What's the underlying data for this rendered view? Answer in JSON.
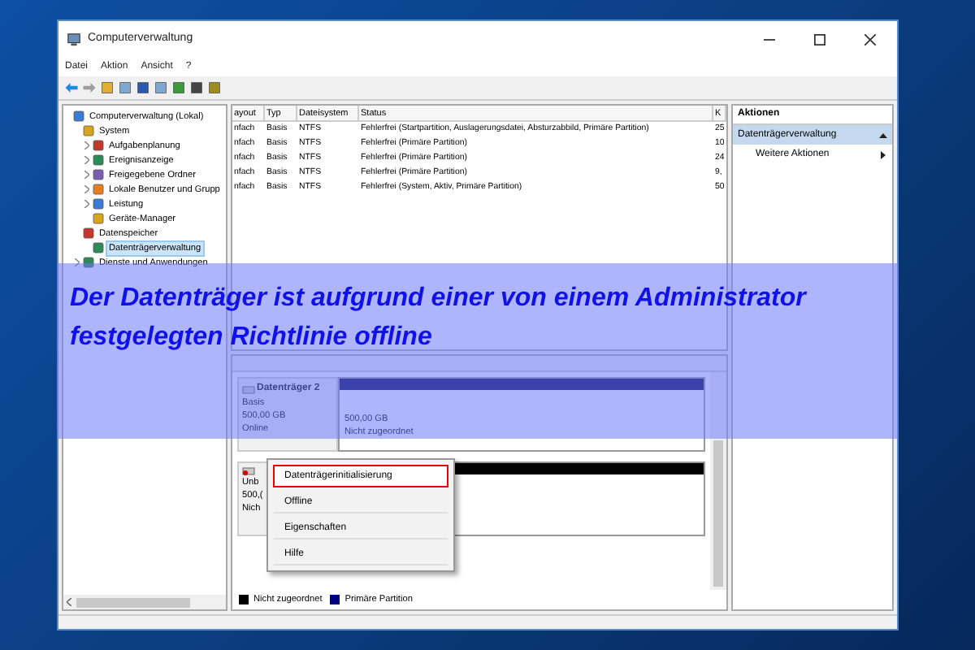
{
  "window": {
    "title": "Computerverwaltung"
  },
  "menu": [
    "Datei",
    "Aktion",
    "Ansicht",
    "?"
  ],
  "tree": [
    {
      "label": "Computerverwaltung (Lokal)",
      "selected": false,
      "expanded": true,
      "children": [
        {
          "label": "System",
          "selected": false,
          "expanded": true,
          "children": [
            {
              "label": "Aufgabenplanung",
              "selected": false,
              "expanded": false
            },
            {
              "label": "Ereignisanzeige",
              "selected": false,
              "expanded": false
            },
            {
              "label": "Freigegebene Ordner",
              "selected": false,
              "expanded": false
            },
            {
              "label": "Lokale Benutzer und Grupp",
              "selected": false,
              "expanded": false
            },
            {
              "label": "Leistung",
              "selected": false,
              "expanded": false
            },
            {
              "label": "Geräte-Manager",
              "selected": false
            }
          ]
        },
        {
          "label": "Datenspeicher",
          "selected": false,
          "expanded": true,
          "children": [
            {
              "label": "Datenträgerverwaltung",
              "selected": true
            }
          ]
        },
        {
          "label": "Dienste und Anwendungen",
          "selected": false,
          "expanded": false
        }
      ]
    }
  ],
  "table": {
    "columns": [
      "ayout",
      "Typ",
      "Dateisystem",
      "Status",
      "K"
    ],
    "rows": [
      [
        "nfach",
        "Basis",
        "NTFS",
        "Fehlerfrei (Startpartition, Auslagerungsdatei, Absturzabbild, Primäre Partition)",
        "25"
      ],
      [
        "nfach",
        "Basis",
        "NTFS",
        "Fehlerfrei (Primäre Partition)",
        "10"
      ],
      [
        "nfach",
        "Basis",
        "NTFS",
        "Fehlerfrei (Primäre Partition)",
        "24"
      ],
      [
        "nfach",
        "Basis",
        "NTFS",
        "Fehlerfrei (Primäre Partition)",
        "9,"
      ],
      [
        "nfach",
        "Basis",
        "NTFS",
        "Fehlerfrei (System, Aktiv, Primäre Partition)",
        "50"
      ]
    ]
  },
  "disks": [
    {
      "name": "Datenträger 2",
      "info": [
        "Basis",
        "500,00 GB",
        "Online"
      ],
      "partition": {
        "size": "500,00 GB",
        "status": "Nicht zugeordnet"
      }
    },
    {
      "info": [
        "Unb",
        "500,(",
        "Nich"
      ]
    }
  ],
  "context_menu": [
    {
      "label": "Datenträgerinitialisierung",
      "selected": true
    },
    {
      "label": "Offline",
      "selected": false
    },
    {
      "label": "Eigenschaften",
      "selected": false
    },
    {
      "label": "Hilfe",
      "selected": false
    }
  ],
  "legend": [
    {
      "label": "Nicht zugeordnet",
      "color": "#000000"
    },
    {
      "label": "Primäre Partition",
      "color": "#00007f"
    }
  ],
  "actions": {
    "header": "Aktionen",
    "section": "Datenträgerverwaltung",
    "items": [
      "Weitere Aktionen"
    ]
  },
  "banner": {
    "text": "Der Datenträger ist aufgrund einer von einem Administrator festgelegten Richtlinie offline"
  }
}
